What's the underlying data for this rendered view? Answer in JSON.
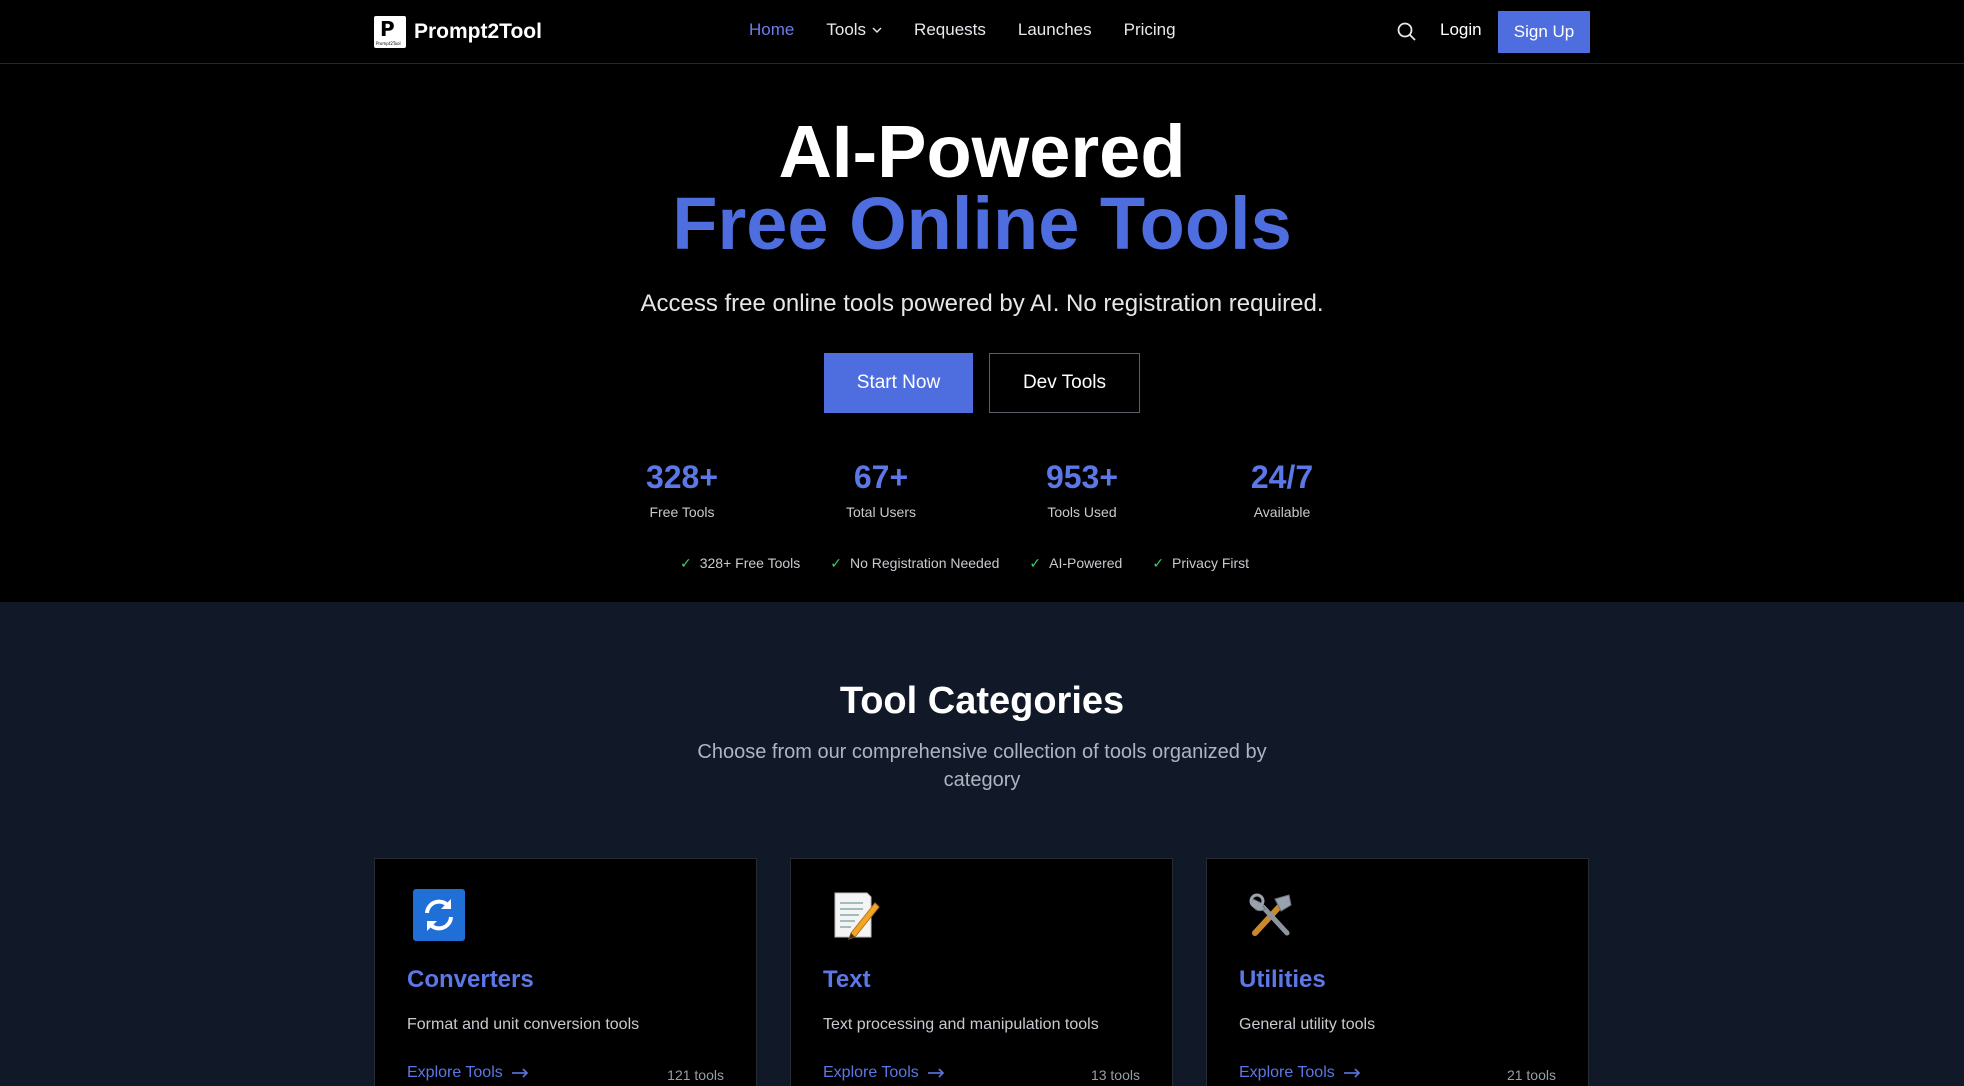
{
  "brand": {
    "name": "Prompt2Tool",
    "logo_letter": "P",
    "logo_small": "Prompt2Tool"
  },
  "nav": {
    "items": [
      {
        "label": "Home",
        "active": true
      },
      {
        "label": "Tools",
        "dropdown": true
      },
      {
        "label": "Requests"
      },
      {
        "label": "Launches"
      },
      {
        "label": "Pricing"
      }
    ],
    "login": "Login",
    "signup": "Sign Up"
  },
  "hero": {
    "title_line1": "AI-Powered",
    "title_line2": "Free Online Tools",
    "subtitle": "Access free online tools powered by AI. No registration required.",
    "primary_button": "Start Now",
    "secondary_button": "Dev Tools",
    "stats": [
      {
        "value": "328+",
        "label": "Free Tools"
      },
      {
        "value": "67+",
        "label": "Total Users"
      },
      {
        "value": "953+",
        "label": "Tools Used"
      },
      {
        "value": "24/7",
        "label": "Available"
      }
    ],
    "features": [
      "328+ Free Tools",
      "No Registration Needed",
      "AI-Powered",
      "Privacy First"
    ],
    "check_glyph": "✓"
  },
  "categories": {
    "title": "Tool Categories",
    "subtitle": "Choose from our comprehensive collection of tools organized by category",
    "cards": [
      {
        "icon": "refresh-icon",
        "title": "Converters",
        "desc": "Format and unit conversion tools",
        "link": "Explore Tools",
        "count": "121 tools"
      },
      {
        "icon": "memo-icon",
        "title": "Text",
        "desc": "Text processing and manipulation tools",
        "link": "Explore Tools",
        "count": "13 tools"
      },
      {
        "icon": "tools-icon",
        "title": "Utilities",
        "desc": "General utility tools",
        "link": "Explore Tools",
        "count": "21 tools"
      }
    ]
  },
  "colors": {
    "accent": "#4e6ee0",
    "accent_text": "#5c77e6",
    "section_bg": "#111827",
    "check": "#3ccf6e"
  }
}
